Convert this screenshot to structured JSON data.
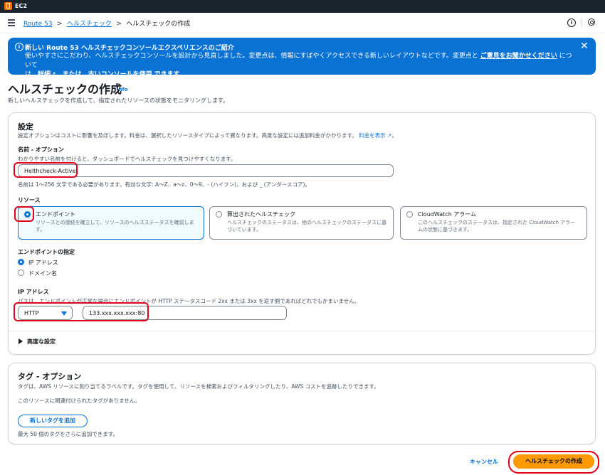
{
  "topbar": {
    "app": "EC2"
  },
  "breadcrumb": {
    "root": "Route 53",
    "parent": "ヘルスチェック",
    "current": "ヘルスチェックの作成",
    "sep": ">"
  },
  "flash": {
    "title": "新しい Route 53 ヘルスチェックコンソールエクスペリエンスのご紹介",
    "line1_a": "使いやすさにこだわり、ヘルスチェックコンソールを設計から見直しました。変更点は、情報にすばやくアクセスできる新しいレイアウトなどです。変更点と",
    "line1_link": "ご意見をお聞かせください",
    "line1_b": "について",
    "line2_a": "は、",
    "line2_link1": "詳細",
    "line2_b": "。または、",
    "line2_link2": "古いコンソールを使用",
    "line2_c": "できます。",
    "close": "✕"
  },
  "page": {
    "title": "ヘルスチェックの作成",
    "info": "Info",
    "description": "新しいヘルスチェックを作成して、指定されたリソースの状態をモニタリングします。"
  },
  "settings": {
    "header": "設定",
    "description": "設定オプションはコストに影響を及ぼします。料金は、選択したリソースタイプによって異なります。高度な設定には追加料金がかかります。",
    "pricing_link": "料金を表示",
    "name_label": "名前 - オプション",
    "name_hint": "わかりやすい名前を付けると、ダッシュボードでヘルスチェックを見つけやすくなります。",
    "name_value": "Helthcheck-Active",
    "name_constraint": "名前は 1～256 文字である必要があります。有効な文字: A～Z、a～z、0～9、- (ハイフン)、および _ (アンダースコア)。",
    "resource_label": "リソース",
    "resources": [
      {
        "title": "エンドポイント",
        "desc": "リソースとの接続を確立して、リソースのヘルスステータスを確認します。"
      },
      {
        "title": "算出されたヘルスチェック",
        "desc": "ヘルスチェックのステータスは、他のヘルスチェックのステータスに基づいています。"
      },
      {
        "title": "CloudWatch アラーム",
        "desc": "このヘルスチェックのステータスは、指定された CloudWatch アラームの状態に基づきます。"
      }
    ],
    "endpoint_spec_label": "エンドポイントの指定",
    "endpoint_options": [
      "IP アドレス",
      "ドメイン名"
    ],
    "ip_label": "IP アドレス",
    "ip_hint": "パスは、エンドポイントが正常な場合にエンドポイントが HTTP ステータスコード 2xx または 3xx を返す側であればどれでもかまいません。",
    "protocol": "HTTP",
    "ip_value": "133.xxx.xxx.xxx:80",
    "advanced": "高度な設定"
  },
  "tags": {
    "header": "タグ - オプション",
    "description": "タグは、AWS リソースに割り当てるラベルです。タグを使用して、リソースを検索およびフィルタリングしたり、AWS コストを追跡したりできます。",
    "empty": "このリソースに関連付けられたタグがありません。",
    "add_button": "新しいタグを追加",
    "limit": "最大 50 個のタグをさらに追加できます。"
  },
  "footer": {
    "cancel": "キャンセル",
    "create": "ヘルスチェックの作成"
  },
  "colors": {
    "accent": "#0972d3",
    "primary_button": "#ff9900",
    "annotation": "#e0001b"
  }
}
